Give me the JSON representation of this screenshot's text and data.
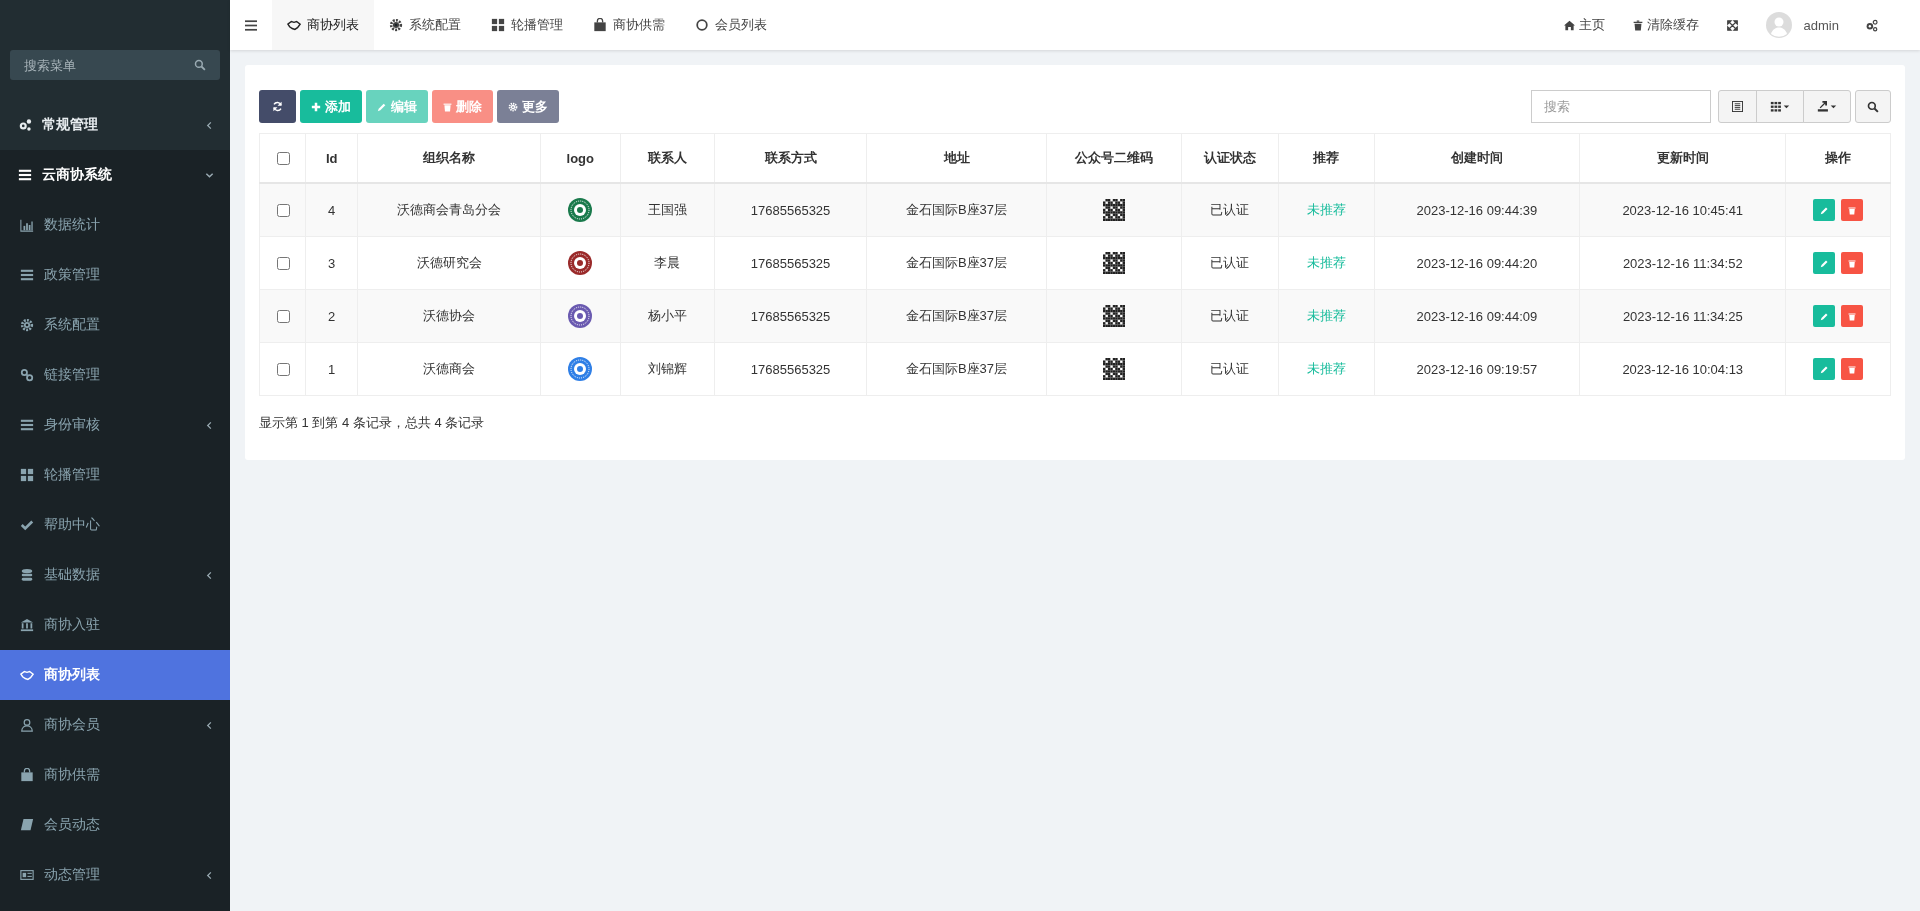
{
  "sidebar": {
    "search": {
      "placeholder": "搜索菜单"
    },
    "items": [
      {
        "label": "常规管理",
        "kind": "group",
        "expanded": false,
        "selected": false
      },
      {
        "label": "云商协系统",
        "kind": "group",
        "expanded": true,
        "selected": false,
        "children": [
          {
            "label": "数据统计",
            "kind": "link",
            "selected": false
          },
          {
            "label": "政策管理",
            "kind": "link",
            "selected": false
          },
          {
            "label": "系统配置",
            "kind": "link",
            "selected": false
          },
          {
            "label": "链接管理",
            "kind": "link",
            "selected": false
          },
          {
            "label": "身份审核",
            "kind": "group",
            "expanded": false,
            "selected": false
          },
          {
            "label": "轮播管理",
            "kind": "link",
            "selected": false
          },
          {
            "label": "帮助中心",
            "kind": "link",
            "selected": false
          },
          {
            "label": "基础数据",
            "kind": "group",
            "expanded": false,
            "selected": false
          },
          {
            "label": "商协入驻",
            "kind": "link",
            "selected": false
          },
          {
            "label": "商协列表",
            "kind": "link",
            "selected": true
          },
          {
            "label": "商协会员",
            "kind": "group",
            "expanded": false,
            "selected": false
          },
          {
            "label": "商协供需",
            "kind": "link",
            "selected": false
          },
          {
            "label": "会员动态",
            "kind": "link",
            "selected": false
          },
          {
            "label": "动态管理",
            "kind": "group",
            "expanded": false,
            "selected": false
          }
        ]
      }
    ]
  },
  "tabs": [
    {
      "label": "商协列表",
      "selected": true
    },
    {
      "label": "系统配置",
      "selected": false
    },
    {
      "label": "轮播管理",
      "selected": false
    },
    {
      "label": "商协供需",
      "selected": false
    },
    {
      "label": "会员列表",
      "selected": false
    }
  ],
  "header_links": [
    {
      "label": "主页"
    },
    {
      "label": "清除缓存"
    }
  ],
  "user": {
    "name": "admin"
  },
  "toolbar": {
    "buttons": [
      {
        "kind": "refresh",
        "disabled": false
      },
      {
        "kind": "add",
        "label": "添加",
        "disabled": false
      },
      {
        "kind": "edit",
        "label": "编辑",
        "disabled": true
      },
      {
        "kind": "delete",
        "label": "删除",
        "disabled": true
      },
      {
        "kind": "more",
        "label": "更多",
        "disabled": false
      }
    ],
    "search": {
      "placeholder": "搜索"
    }
  },
  "table": {
    "columns": [
      "Id",
      "组织名称",
      "logo",
      "联系人",
      "联系方式",
      "地址",
      "公众号二维码",
      "认证状态",
      "推荐",
      "创建时间",
      "更新时间",
      "操作"
    ],
    "select_all": {
      "checked": false
    },
    "rows": [
      {
        "checked": false,
        "id": "4",
        "name": "沃德商会青岛分会",
        "color": "#1a7a4c",
        "contact": "王国强",
        "phone": "17685565325",
        "address": "金石国际B座37层",
        "status": "已认证",
        "recommend": "未推荐",
        "created": "2023-12-16 09:44:39",
        "updated": "2023-12-16 10:45:41"
      },
      {
        "checked": false,
        "id": "3",
        "name": "沃德研究会",
        "color": "#9a2a2a",
        "contact": "李晨",
        "phone": "17685565325",
        "address": "金石国际B座37层",
        "status": "已认证",
        "recommend": "未推荐",
        "created": "2023-12-16 09:44:20",
        "updated": "2023-12-16 11:34:52"
      },
      {
        "checked": false,
        "id": "2",
        "name": "沃德协会",
        "color": "#6a5ab0",
        "contact": "杨小平",
        "phone": "17685565325",
        "address": "金石国际B座37层",
        "status": "已认证",
        "recommend": "未推荐",
        "created": "2023-12-16 09:44:09",
        "updated": "2023-12-16 11:34:25"
      },
      {
        "checked": false,
        "id": "1",
        "name": "沃德商会",
        "color": "#2f7fe6",
        "contact": "刘锦辉",
        "phone": "17685565325",
        "address": "金石国际B座37层",
        "status": "已认证",
        "recommend": "未推荐",
        "created": "2023-12-16 09:19:57",
        "updated": "2023-12-16 10:04:13"
      }
    ],
    "footer": "显示第 1 到第 4 条记录，总共 4 条记录"
  }
}
